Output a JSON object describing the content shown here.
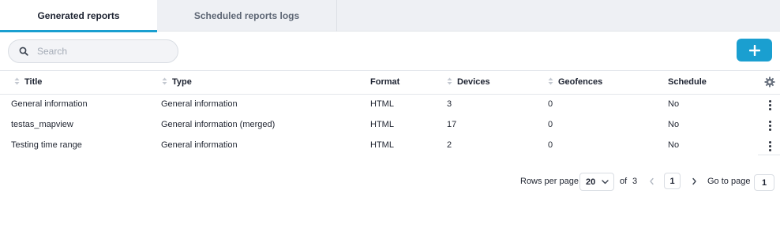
{
  "tabs": [
    {
      "label": "Generated reports",
      "active": true
    },
    {
      "label": "Scheduled reports logs",
      "active": false
    }
  ],
  "search": {
    "placeholder": "Search",
    "value": ""
  },
  "add_button": {
    "icon": "plus-icon",
    "color": "#1a9fd0"
  },
  "table": {
    "columns": {
      "title": "Title",
      "type": "Type",
      "format": "Format",
      "devices": "Devices",
      "geofences": "Geofences",
      "schedule": "Schedule"
    },
    "settings_icon": "gear-icon",
    "rows": [
      {
        "title": "General information",
        "type": "General information",
        "format": "HTML",
        "devices": "3",
        "geofences": "0",
        "schedule": "No"
      },
      {
        "title": "testas_mapview",
        "type": "General information (merged)",
        "format": "HTML",
        "devices": "17",
        "geofences": "0",
        "schedule": "No"
      },
      {
        "title": "Testing time range",
        "type": "General information",
        "format": "HTML",
        "devices": "2",
        "geofences": "0",
        "schedule": "No"
      }
    ]
  },
  "pagination": {
    "rows_per_page_label": "Rows per page",
    "rows_per_page_value": "20",
    "of_label": "of",
    "total_pages": "3",
    "current_page": "1",
    "go_to_page_label": "Go to page",
    "go_to_page_value": "1"
  },
  "colors": {
    "accent": "#1a9fd0",
    "tabbar_bg": "#eef0f4",
    "border": "#e3e6eb"
  }
}
